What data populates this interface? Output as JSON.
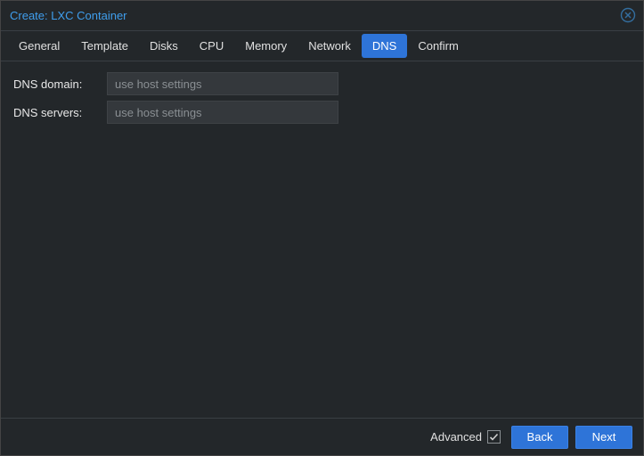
{
  "title": "Create: LXC Container",
  "tabs": [
    {
      "label": "General"
    },
    {
      "label": "Template"
    },
    {
      "label": "Disks"
    },
    {
      "label": "CPU"
    },
    {
      "label": "Memory"
    },
    {
      "label": "Network"
    },
    {
      "label": "DNS",
      "active": true
    },
    {
      "label": "Confirm"
    }
  ],
  "form": {
    "dns_domain": {
      "label": "DNS domain:",
      "value": "",
      "placeholder": "use host settings"
    },
    "dns_servers": {
      "label": "DNS servers:",
      "value": "",
      "placeholder": "use host settings"
    }
  },
  "footer": {
    "advanced_label": "Advanced",
    "advanced_checked": true,
    "back_label": "Back",
    "next_label": "Next"
  },
  "icons": {
    "close": "close-icon",
    "check": "check-icon"
  }
}
